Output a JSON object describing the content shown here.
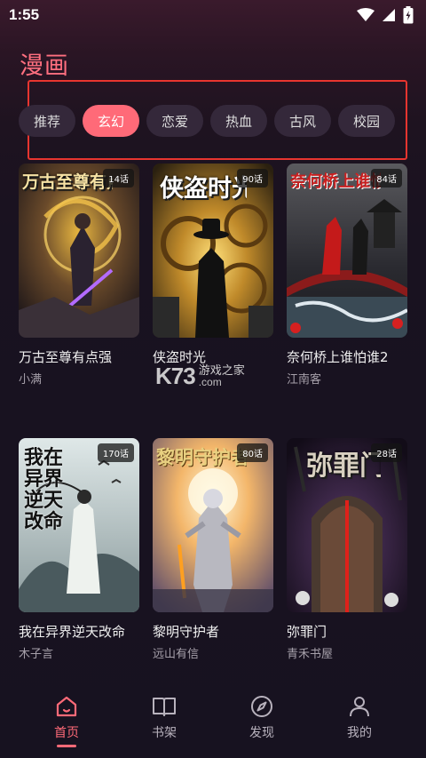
{
  "status_bar": {
    "time": "1:55"
  },
  "page_title": "漫画",
  "tabs": [
    {
      "label": "推荐",
      "active": false
    },
    {
      "label": "玄幻",
      "active": true
    },
    {
      "label": "恋爱",
      "active": false
    },
    {
      "label": "热血",
      "active": false
    },
    {
      "label": "古风",
      "active": false
    },
    {
      "label": "校园",
      "active": false
    }
  ],
  "comics": [
    {
      "title": "万古至尊有点强",
      "author": "小满",
      "episodes": "14话",
      "cover_text": "万古至尊有点强",
      "icon": "dragon-warrior-cover"
    },
    {
      "title": "侠盗时光",
      "author": "",
      "episodes": "90话",
      "cover_text": "侠盗时光",
      "icon": "clockwork-thief-cover"
    },
    {
      "title": "奈何桥上谁怕谁2",
      "author": "江南客",
      "episodes": "84话",
      "cover_text": "奈何桥上谁怕谁",
      "icon": "red-bridge-cover"
    },
    {
      "title": "我在异界逆天改命",
      "author": "木子言",
      "episodes": "170话",
      "cover_text": "我在异界逆天改命",
      "icon": "ink-cultivator-cover"
    },
    {
      "title": "黎明守护者",
      "author": "远山有信",
      "episodes": "80话",
      "cover_text": "黎明守护者",
      "icon": "golden-knight-cover"
    },
    {
      "title": "弥罪门",
      "author": "青禾书屋",
      "episodes": "28话",
      "cover_text": "弥罪门",
      "icon": "dark-gate-cover"
    }
  ],
  "watermark": {
    "logo": "K73",
    "cn": "游戏之家",
    "com": ".com"
  },
  "bottom_nav": [
    {
      "label": "首页",
      "icon": "home-icon",
      "active": true
    },
    {
      "label": "书架",
      "icon": "book-icon",
      "active": false
    },
    {
      "label": "发现",
      "icon": "compass-icon",
      "active": false
    },
    {
      "label": "我的",
      "icon": "person-icon",
      "active": false
    }
  ],
  "colors": {
    "accent": "#ff6a78",
    "title": "#ff6f7f",
    "highlight_box": "#e8352f"
  }
}
